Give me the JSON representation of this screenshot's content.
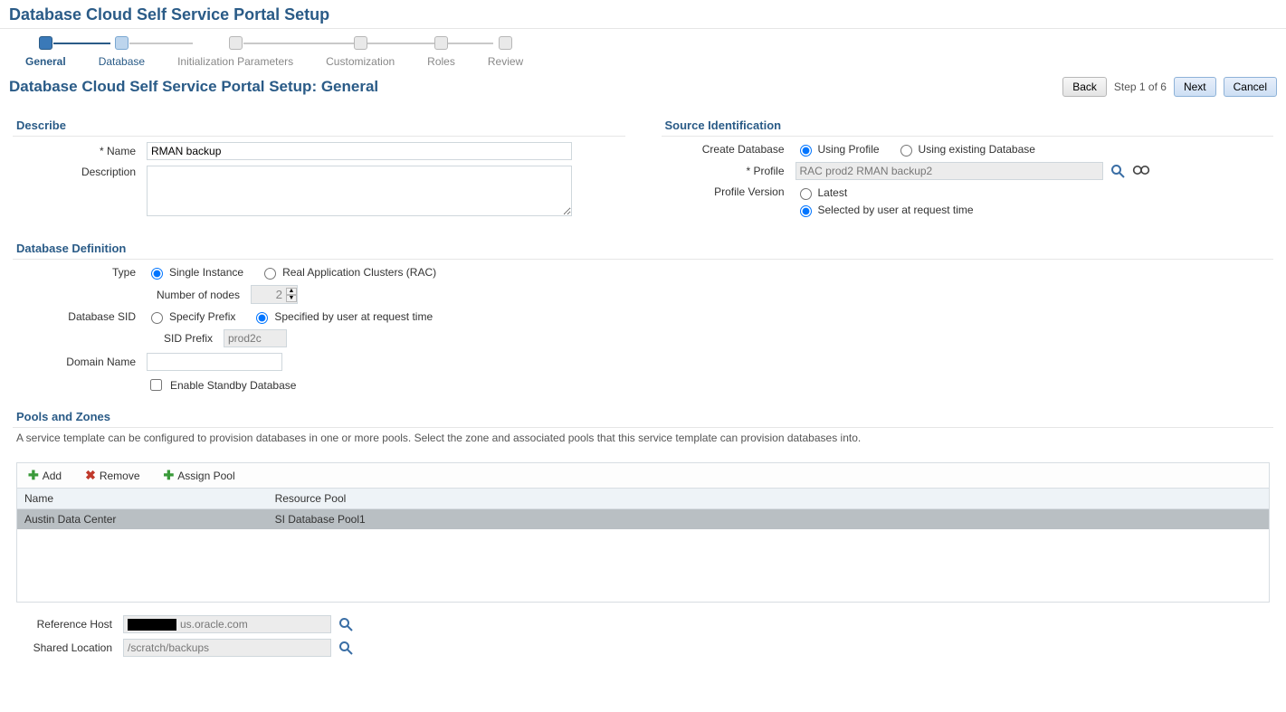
{
  "page_title": "Database Cloud Self Service Portal Setup",
  "wizard_steps": [
    "General",
    "Database",
    "Initialization Parameters",
    "Customization",
    "Roles",
    "Review"
  ],
  "section_title": "Database Cloud Self Service Portal Setup: General",
  "buttons": {
    "back": "Back",
    "next": "Next",
    "cancel": "Cancel"
  },
  "step_text": "Step 1 of 6",
  "describe": {
    "title": "Describe",
    "name_label": "Name",
    "name_value": "RMAN backup",
    "desc_label": "Description",
    "desc_value": ""
  },
  "source": {
    "title": "Source Identification",
    "create_db_label": "Create Database",
    "opt_profile": "Using Profile",
    "opt_existing": "Using existing Database",
    "profile_label": "Profile",
    "profile_value": "RAC prod2 RMAN backup2",
    "pv_label": "Profile Version",
    "pv_latest": "Latest",
    "pv_sel": "Selected by user at request time"
  },
  "dbdef": {
    "title": "Database Definition",
    "type_label": "Type",
    "type_single": "Single Instance",
    "type_rac": "Real Application Clusters (RAC)",
    "nodes_label": "Number of nodes",
    "nodes_value": "2",
    "sid_label": "Database SID",
    "sid_prefix": "Specify Prefix",
    "sid_user": "Specified by user at request time",
    "sidp_label": "SID Prefix",
    "sidp_value": "prod2c",
    "domain_label": "Domain Name",
    "domain_value": "",
    "standby_label": "Enable Standby Database"
  },
  "pools": {
    "title": "Pools and Zones",
    "desc": "A service template can be configured to provision databases in one or more pools. Select the zone and associated pools that this service template can provision databases into.",
    "tb_add": "Add",
    "tb_remove": "Remove",
    "tb_assign": "Assign Pool",
    "col_name": "Name",
    "col_pool": "Resource Pool",
    "row_name": "Austin Data Center",
    "row_pool": "SI Database Pool1",
    "ref_host_label": "Reference Host",
    "ref_host_suffix": "us.oracle.com",
    "shared_label": "Shared Location",
    "shared_value": "/scratch/backups"
  }
}
